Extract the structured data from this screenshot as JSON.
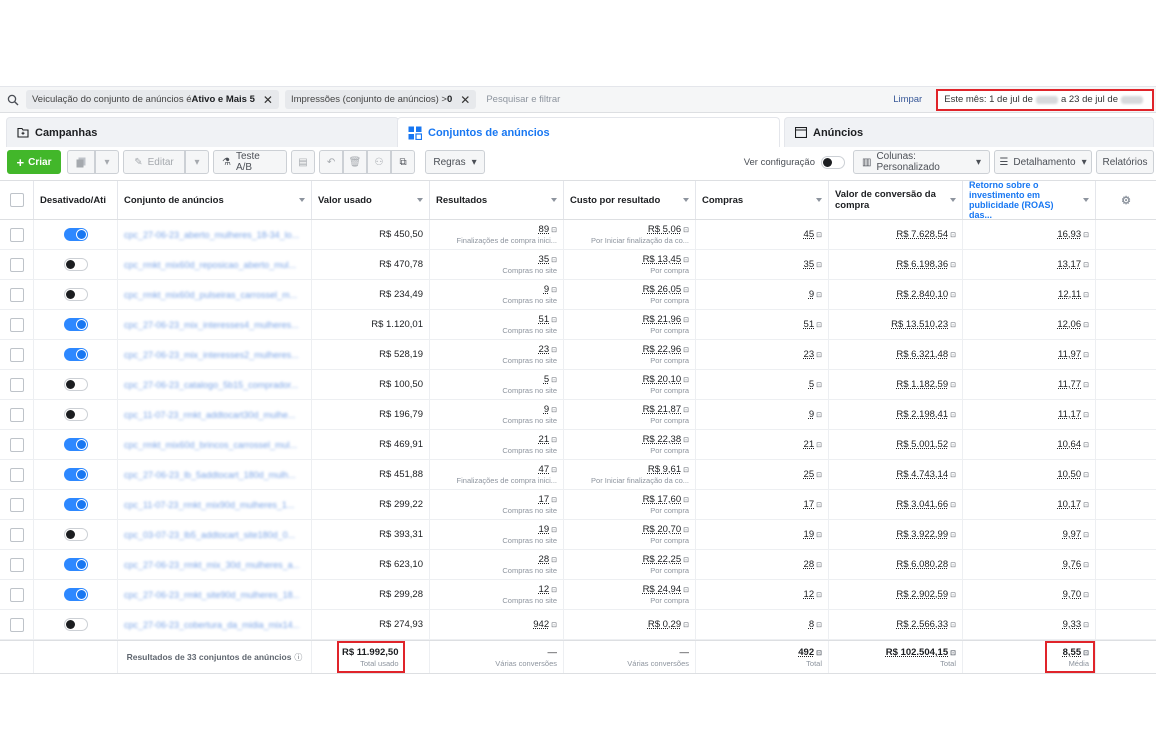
{
  "filters": {
    "chip1_text": "Veiculação do conjunto de anúncios é ",
    "chip1_value": "Ativo e Mais 5",
    "chip2_text": "Impressões (conjunto de anúncios) > ",
    "chip2_value": "0",
    "placeholder": "Pesquisar e filtrar",
    "limpar": "Limpar",
    "date_prefix": "Este mês: 1 de jul de",
    "date_middle": "a 23 de jul de"
  },
  "tabs": [
    {
      "label": "Campanhas",
      "icon": "folder-icon"
    },
    {
      "label": "Conjuntos de anúncios",
      "icon": "grid-icon"
    },
    {
      "label": "Anúncios",
      "icon": "ad-icon"
    }
  ],
  "toolbar": {
    "criar": "Criar",
    "editar": "Editar",
    "teste": "Teste A/B",
    "regras": "Regras",
    "ver_config": "Ver configuração",
    "colunas": "Colunas: Personalizado",
    "detalhamento": "Detalhamento",
    "relatorios": "Relatórios"
  },
  "columns": {
    "toggle": "Desativado/Ati",
    "name": "Conjunto de anúncios",
    "valor": "Valor usado",
    "resultados": "Resultados",
    "custo": "Custo por resultado",
    "compras": "Compras",
    "conv": "Valor de conversão da compra",
    "roas": "Retorno sobre o investimento em publicidade (ROAS) das..."
  },
  "rows": [
    {
      "on": true,
      "name": "cpc_27-06-23_aberto_mulheres_18-34_lo...",
      "valor": "R$ 450,50",
      "res": "89",
      "res_sub": "Finalizações de compra inici...",
      "custo": "R$ 5,06",
      "custo_sub": "Por Iniciar finalização da co...",
      "compras": "45",
      "conv": "R$ 7.628,54",
      "roas": "16,93"
    },
    {
      "on": false,
      "name": "cpc_rmkt_mix60d_reposicao_aberto_mul...",
      "valor": "R$ 470,78",
      "res": "35",
      "res_sub": "Compras no site",
      "custo": "R$ 13,45",
      "custo_sub": "Por compra",
      "compras": "35",
      "conv": "R$ 6.198,36",
      "roas": "13,17"
    },
    {
      "on": false,
      "name": "cpc_rmkt_mix60d_pulseiras_carrossel_m...",
      "valor": "R$ 234,49",
      "res": "9",
      "res_sub": "Compras no site",
      "custo": "R$ 26,05",
      "custo_sub": "Por compra",
      "compras": "9",
      "conv": "R$ 2.840,10",
      "roas": "12,11"
    },
    {
      "on": true,
      "name": "cpc_27-06-23_mix_interesses4_mulheres...",
      "valor": "R$ 1.120,01",
      "res": "51",
      "res_sub": "Compras no site",
      "custo": "R$ 21,96",
      "custo_sub": "Por compra",
      "compras": "51",
      "conv": "R$ 13.510,23",
      "roas": "12,06"
    },
    {
      "on": true,
      "name": "cpc_27-06-23_mix_interesses2_mulheres...",
      "valor": "R$ 528,19",
      "res": "23",
      "res_sub": "Compras no site",
      "custo": "R$ 22,96",
      "custo_sub": "Por compra",
      "compras": "23",
      "conv": "R$ 6.321,48",
      "roas": "11,97"
    },
    {
      "on": false,
      "name": "cpc_27-06-23_catalogo_5b15_comprador...",
      "valor": "R$ 100,50",
      "res": "5",
      "res_sub": "Compras no site",
      "custo": "R$ 20,10",
      "custo_sub": "Por compra",
      "compras": "5",
      "conv": "R$ 1.182,59",
      "roas": "11,77"
    },
    {
      "on": false,
      "name": "cpc_11-07-23_rmkt_addtocart30d_mulhe...",
      "valor": "R$ 196,79",
      "res": "9",
      "res_sub": "Compras no site",
      "custo": "R$ 21,87",
      "custo_sub": "Por compra",
      "compras": "9",
      "conv": "R$ 2.198,41",
      "roas": "11,17"
    },
    {
      "on": true,
      "name": "cpc_rmkt_mix60d_brincos_carrossel_mul...",
      "valor": "R$ 469,91",
      "res": "21",
      "res_sub": "Compras no site",
      "custo": "R$ 22,38",
      "custo_sub": "Por compra",
      "compras": "21",
      "conv": "R$ 5.001,52",
      "roas": "10,64"
    },
    {
      "on": true,
      "name": "cpc_27-06-23_lb_5addtocart_180d_mulh...",
      "valor": "R$ 451,88",
      "res": "47",
      "res_sub": "Finalizações de compra inici...",
      "custo": "R$ 9,61",
      "custo_sub": "Por Iniciar finalização da co...",
      "compras": "25",
      "conv": "R$ 4.743,14",
      "roas": "10,50"
    },
    {
      "on": true,
      "name": "cpc_11-07-23_rmkt_mix90d_mulheres_1...",
      "valor": "R$ 299,22",
      "res": "17",
      "res_sub": "Compras no site",
      "custo": "R$ 17,60",
      "custo_sub": "Por compra",
      "compras": "17",
      "conv": "R$ 3.041,66",
      "roas": "10,17"
    },
    {
      "on": false,
      "name": "cpc_03-07-23_lb5_addtocart_site180d_0...",
      "valor": "R$ 393,31",
      "res": "19",
      "res_sub": "Compras no site",
      "custo": "R$ 20,70",
      "custo_sub": "Por compra",
      "compras": "19",
      "conv": "R$ 3.922,99",
      "roas": "9,97"
    },
    {
      "on": true,
      "name": "cpc_27-06-23_rmkt_mix_30d_mulheres_a...",
      "valor": "R$ 623,10",
      "res": "28",
      "res_sub": "Compras no site",
      "custo": "R$ 22,25",
      "custo_sub": "Por compra",
      "compras": "28",
      "conv": "R$ 6.080,28",
      "roas": "9,76"
    },
    {
      "on": true,
      "name": "cpc_27-06-23_rmkt_site90d_mulheres_18...",
      "valor": "R$ 299,28",
      "res": "12",
      "res_sub": "Compras no site",
      "custo": "R$ 24,94",
      "custo_sub": "Por compra",
      "compras": "12",
      "conv": "R$ 2.902,59",
      "roas": "9,70"
    },
    {
      "on": false,
      "name": "cpc_27-06-23_cobertura_da_midia_mix14...",
      "valor": "R$ 274,93",
      "res": "942",
      "res_sub": "",
      "custo": "R$ 0,29",
      "custo_sub": "",
      "compras": "8",
      "conv": "R$ 2.566,33",
      "roas": "9,33"
    }
  ],
  "totals": {
    "label": "Resultados de 33 conjuntos de anúncios",
    "valor": "R$ 11.992,50",
    "valor_sub": "Total usado",
    "res": "—",
    "res_sub": "Várias conversões",
    "custo": "—",
    "custo_sub": "Várias conversões",
    "compras": "492",
    "compras_sub": "Total",
    "conv": "R$ 102.504,15",
    "conv_sub": "Total",
    "roas": "8,55",
    "roas_sub": "Média"
  },
  "colors": {
    "accent": "#1877f2",
    "create": "#42b72a",
    "highlight": "#e0242a"
  }
}
